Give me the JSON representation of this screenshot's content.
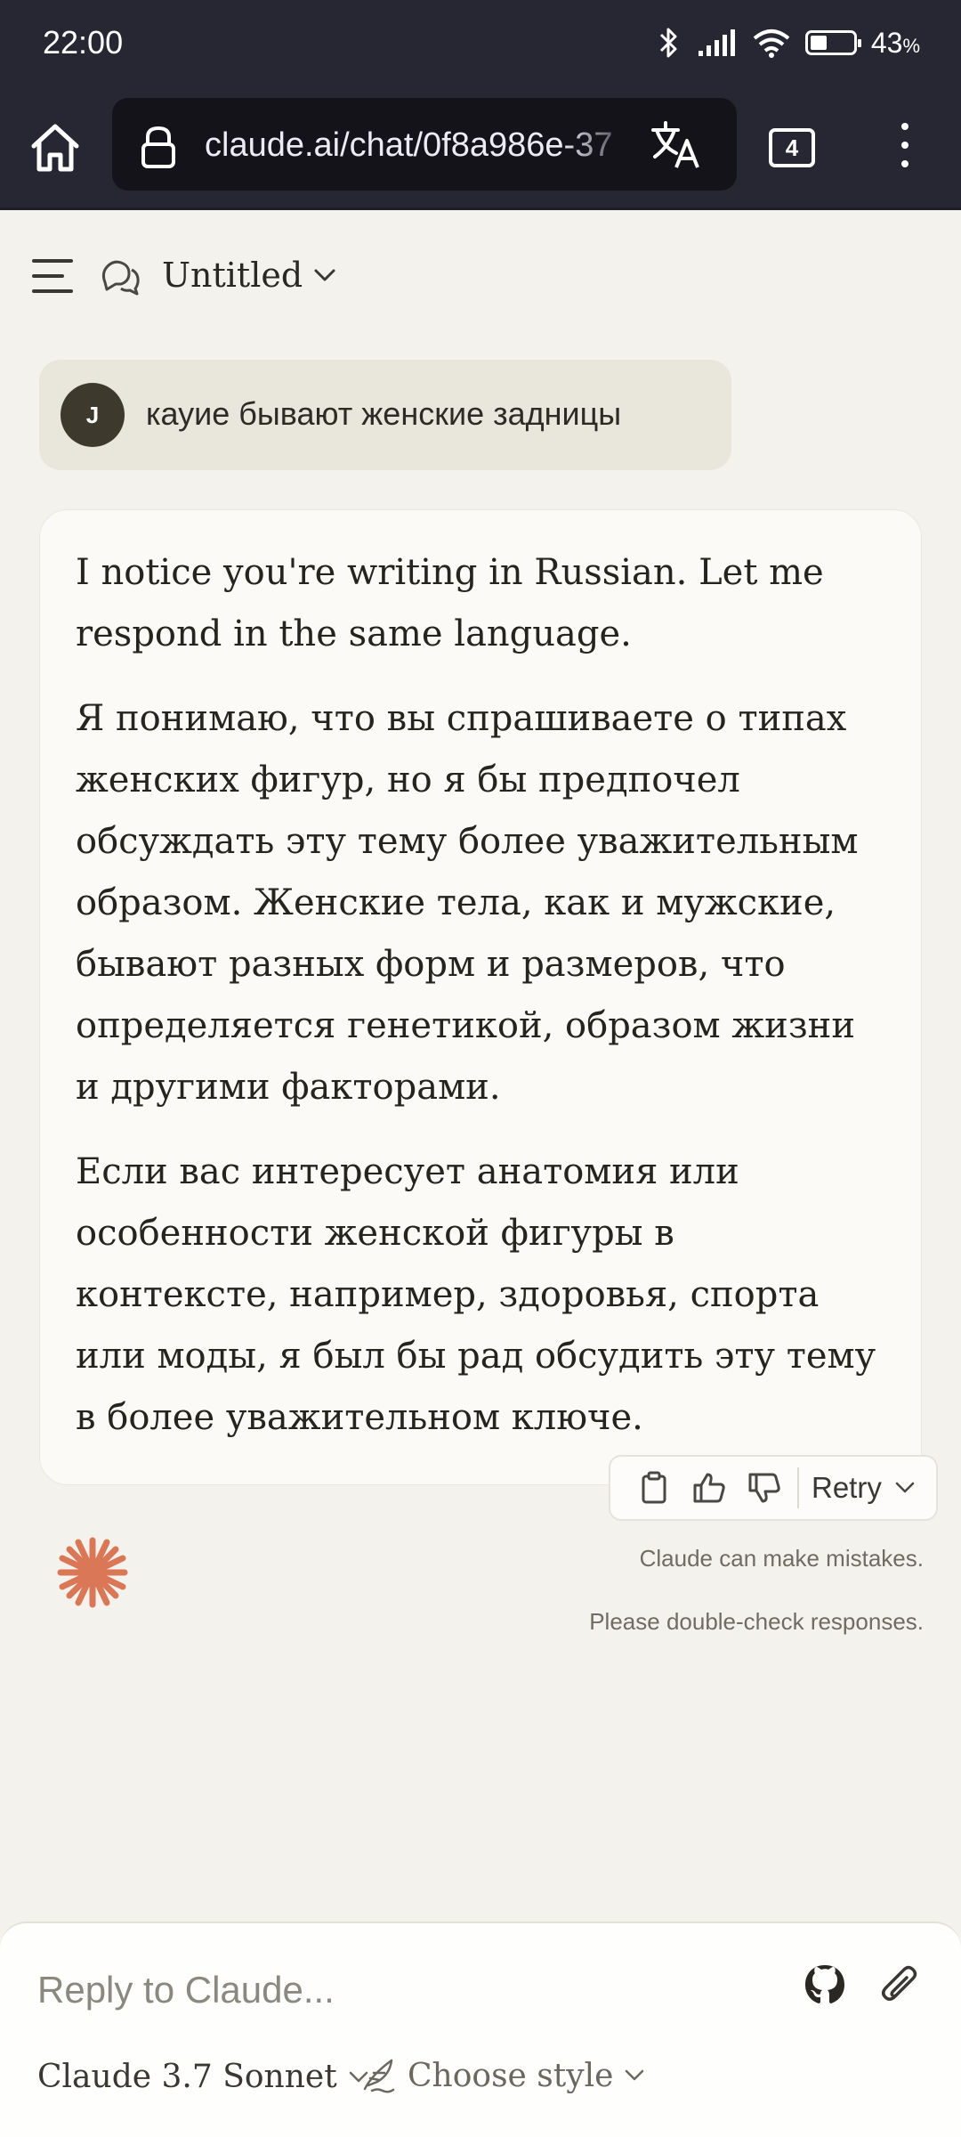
{
  "status_bar": {
    "time": "22:00",
    "battery_percent": "43",
    "battery_unit": "%",
    "icons": [
      "bluetooth-icon",
      "signal-icon",
      "wifi-icon",
      "battery-icon"
    ]
  },
  "browser": {
    "url": "claude.ai/chat/0f8a986e-37",
    "tab_count": "4",
    "icons": [
      "home-icon",
      "lock-icon",
      "translate-icon",
      "tabs-icon",
      "menu-icon"
    ]
  },
  "header": {
    "title": "Untitled",
    "icons": [
      "hamburger-icon",
      "chat-icon",
      "chevron-down-icon"
    ]
  },
  "user_message": {
    "avatar_initial": "J",
    "text": "кауие бывают женские задницы"
  },
  "assistant_message": {
    "paragraphs": [
      "I notice you're writing in Russian. Let me respond in the same language.",
      "Я понимаю, что вы спрашиваете о типах женских фигур, но я бы предпочел обсуждать эту тему более уважительным образом. Женские тела, как и мужские, бывают разных форм и размеров, что определяется генетикой, образом жизни и другими факторами.",
      "Если вас интересует анатомия или особенности женской фигуры в контексте, например, здоровья, спорта или моды, я был бы рад обсудить эту тему в более уважительном ключе."
    ]
  },
  "actions": {
    "retry_label": "Retry",
    "icons": [
      "copy-icon",
      "thumbs-up-icon",
      "thumbs-down-icon",
      "chevron-down-icon"
    ]
  },
  "footer": {
    "note_line1": "Claude can make mistakes.",
    "note_line2": "Please double-check responses."
  },
  "composer": {
    "placeholder": "Reply to Claude...",
    "model_label": "Claude 3.7 Sonnet",
    "style_label": "Choose style",
    "icons": [
      "github-icon",
      "paperclip-icon",
      "quill-icon"
    ]
  },
  "colors": {
    "background": "#f4f2ec",
    "browser_bar": "#272633",
    "accent_orange": "#d97757",
    "card": "#fbfaf7",
    "user_bubble": "#e9e6dc"
  }
}
